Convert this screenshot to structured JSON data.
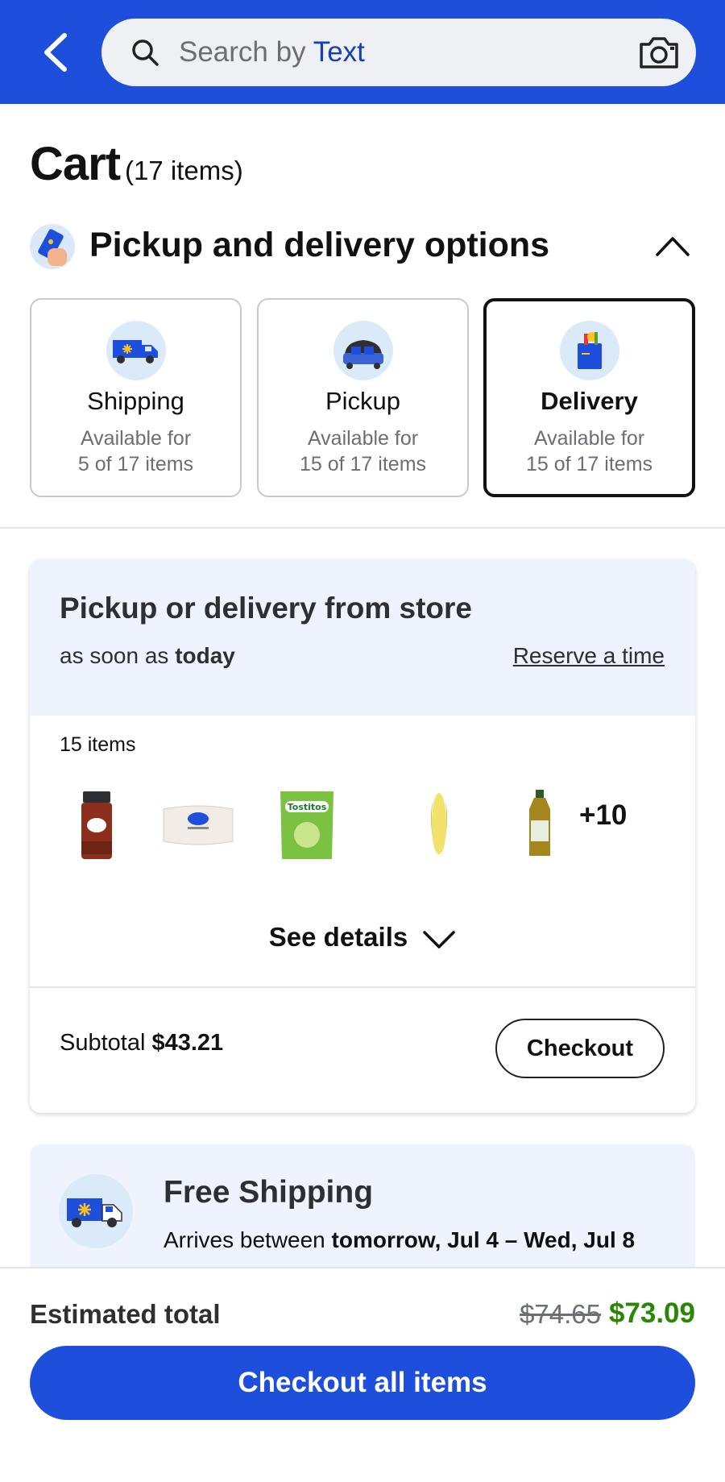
{
  "header": {
    "search_prefix": "Search by ",
    "search_highlight": "Text",
    "colors": {
      "bar": "#1e4fdc"
    }
  },
  "cart": {
    "title": "Cart",
    "count": "(17 items)"
  },
  "options": {
    "title": "Pickup and delivery options",
    "cards": [
      {
        "label": "Shipping",
        "line1": "Available for",
        "line2": "5 of 17 items",
        "icon": "shipping-truck-icon",
        "selected": false
      },
      {
        "label": "Pickup",
        "line1": "Available for",
        "line2": "15 of 17 items",
        "icon": "pickup-car-icon",
        "selected": false
      },
      {
        "label": "Delivery",
        "line1": "Available for",
        "line2": "15 of 17 items",
        "icon": "delivery-bag-icon",
        "selected": true
      }
    ]
  },
  "store": {
    "title": "Pickup or delivery from store",
    "sub_prefix": "as soon as ",
    "sub_bold": "today",
    "reserve": "Reserve a time",
    "items_count": "15 items",
    "thumbs": [
      "paprika-jar",
      "rice-bag",
      "tostitos-chips",
      "corn-cob",
      "oil-bottle"
    ],
    "more": "+10",
    "see_details": "See details",
    "subtotal_label": "Subtotal ",
    "subtotal_value": "$43.21",
    "checkout": "Checkout"
  },
  "shipping": {
    "title": "Free Shipping",
    "sub_prefix": "Arrives between ",
    "sub_bold": "tomorrow, Jul 4 – Wed, Jul 8"
  },
  "footer": {
    "estimated_label": "Estimated total",
    "old_price": "$74.65",
    "new_price": "$73.09",
    "checkout_all": "Checkout all items"
  }
}
